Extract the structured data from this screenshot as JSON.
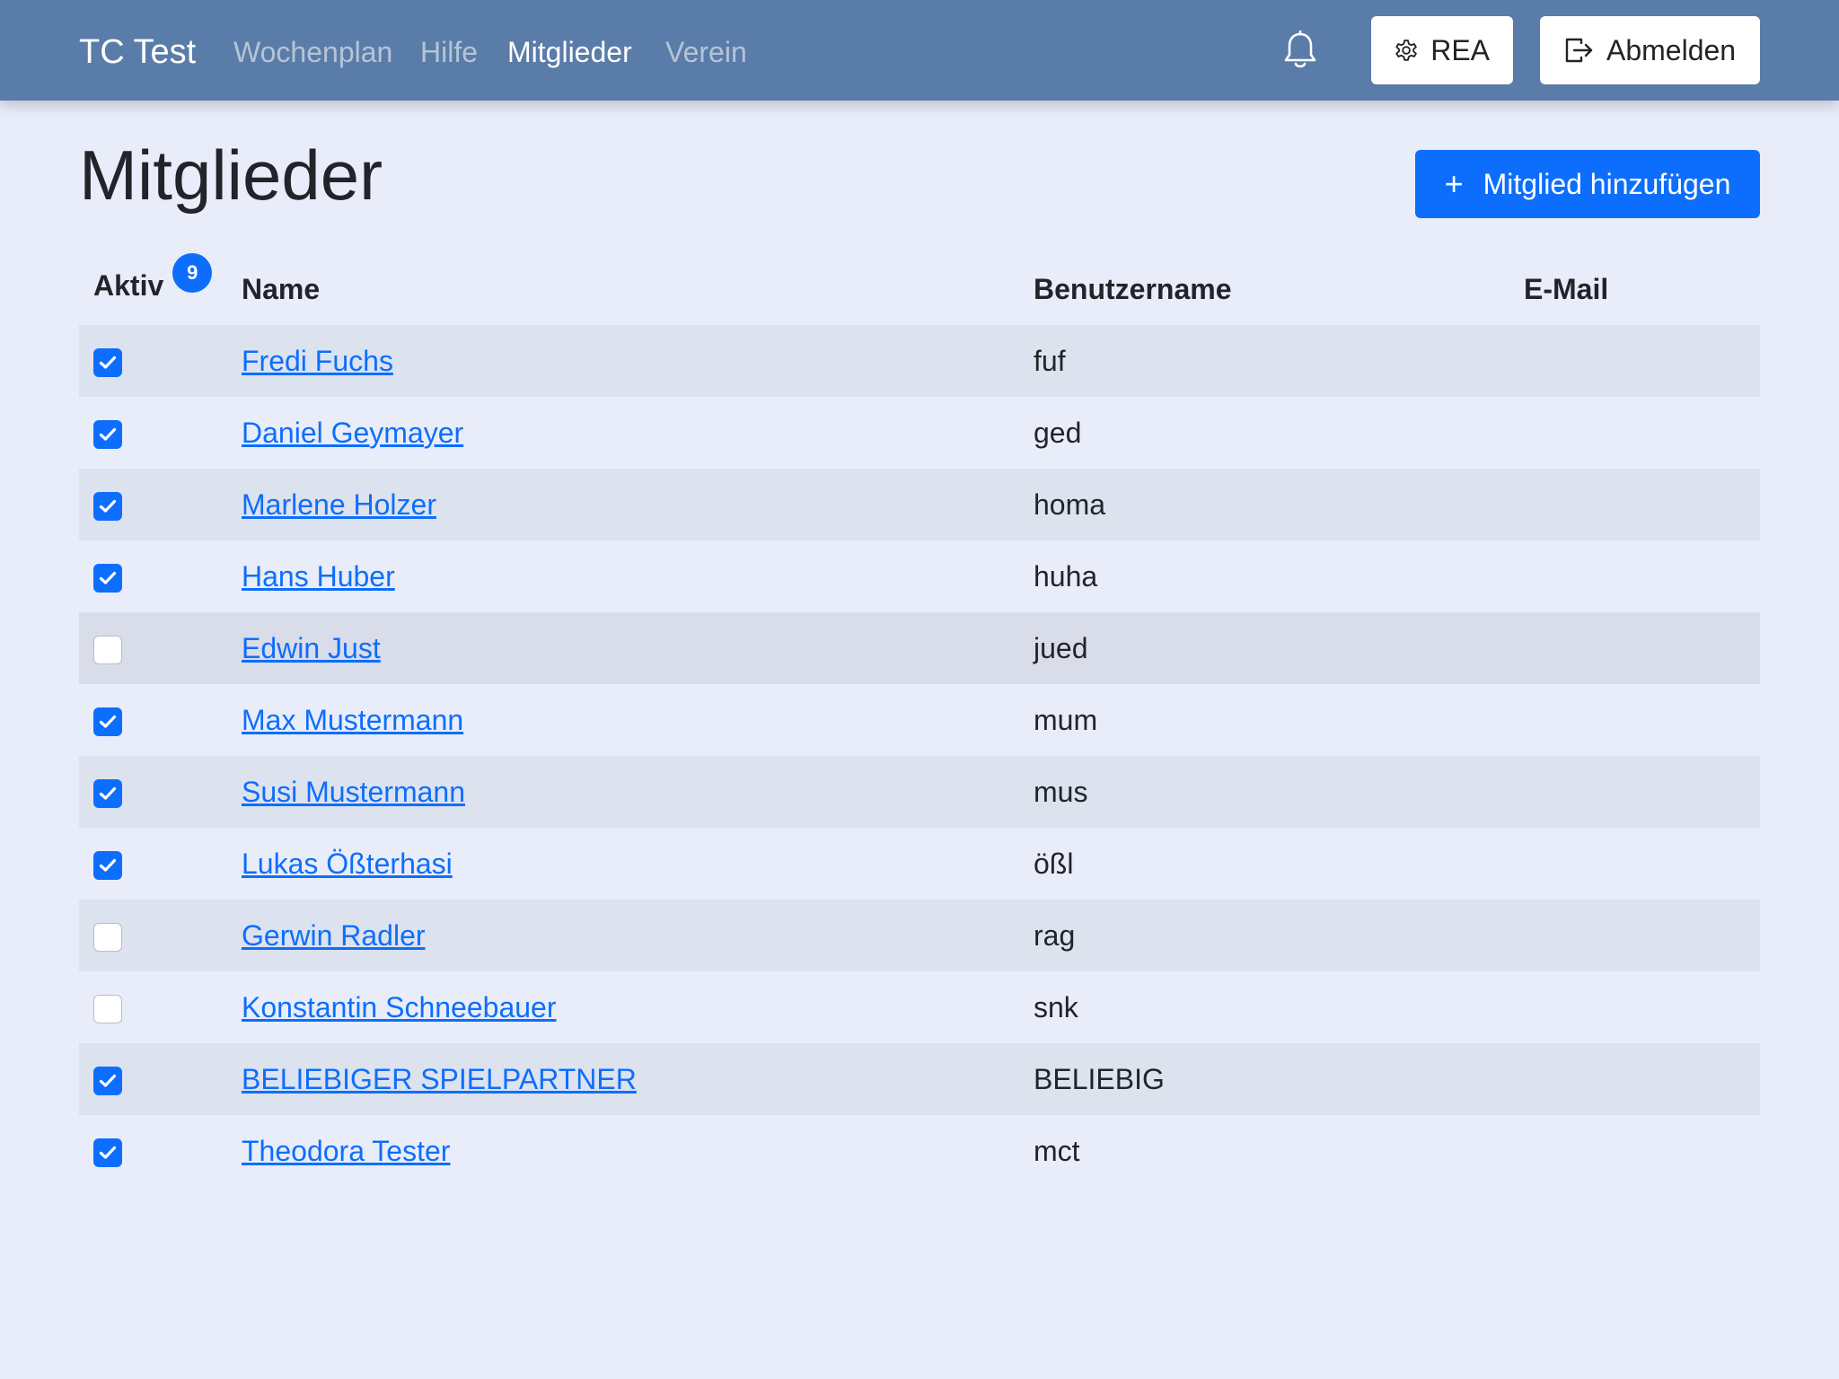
{
  "nav": {
    "brand": "TC Test",
    "links": [
      {
        "label": "Wochenplan",
        "active": false
      },
      {
        "label": "Hilfe",
        "active": false
      },
      {
        "label": "Mitglieder",
        "active": true
      },
      {
        "label": "Verein",
        "active": false
      }
    ],
    "settings_label": "REA",
    "logout_label": "Abmelden",
    "icons": [
      "bell-icon",
      "gear-icon",
      "logout-icon"
    ]
  },
  "page": {
    "title": "Mitglieder",
    "add_button_label": "Mitglied hinzufügen",
    "add_button_icon": "+"
  },
  "table": {
    "headers": {
      "active": "Aktiv",
      "name": "Name",
      "username": "Benutzername",
      "email": "E-Mail"
    },
    "active_count": "9",
    "rows": [
      {
        "active": true,
        "name": "Fredi Fuchs",
        "username": "fuf",
        "email": ""
      },
      {
        "active": true,
        "name": "Daniel Geymayer",
        "username": "ged",
        "email": ""
      },
      {
        "active": true,
        "name": "Marlene Holzer",
        "username": "homa",
        "email": ""
      },
      {
        "active": true,
        "name": "Hans Huber",
        "username": "huha",
        "email": ""
      },
      {
        "active": false,
        "name": "Edwin Just",
        "username": "jued",
        "email": ""
      },
      {
        "active": true,
        "name": "Max Mustermann",
        "username": "mum",
        "email": ""
      },
      {
        "active": true,
        "name": "Susi Mustermann",
        "username": "mus",
        "email": ""
      },
      {
        "active": true,
        "name": "Lukas Ößterhasi",
        "username": "ößl",
        "email": ""
      },
      {
        "active": false,
        "name": "Gerwin Radler",
        "username": "rag",
        "email": ""
      },
      {
        "active": false,
        "name": "Konstantin Schneebauer",
        "username": "snk",
        "email": ""
      },
      {
        "active": true,
        "name": "BELIEBIGER SPIELPARTNER",
        "username": "BELIEBIG",
        "email": ""
      },
      {
        "active": true,
        "name": "Theodora Tester",
        "username": "mct",
        "email": ""
      }
    ]
  },
  "colors": {
    "navbar": "#5a7ca8",
    "primary": "#0d6efd",
    "background": "#e9edfa",
    "stripe": "#dde2ef"
  }
}
